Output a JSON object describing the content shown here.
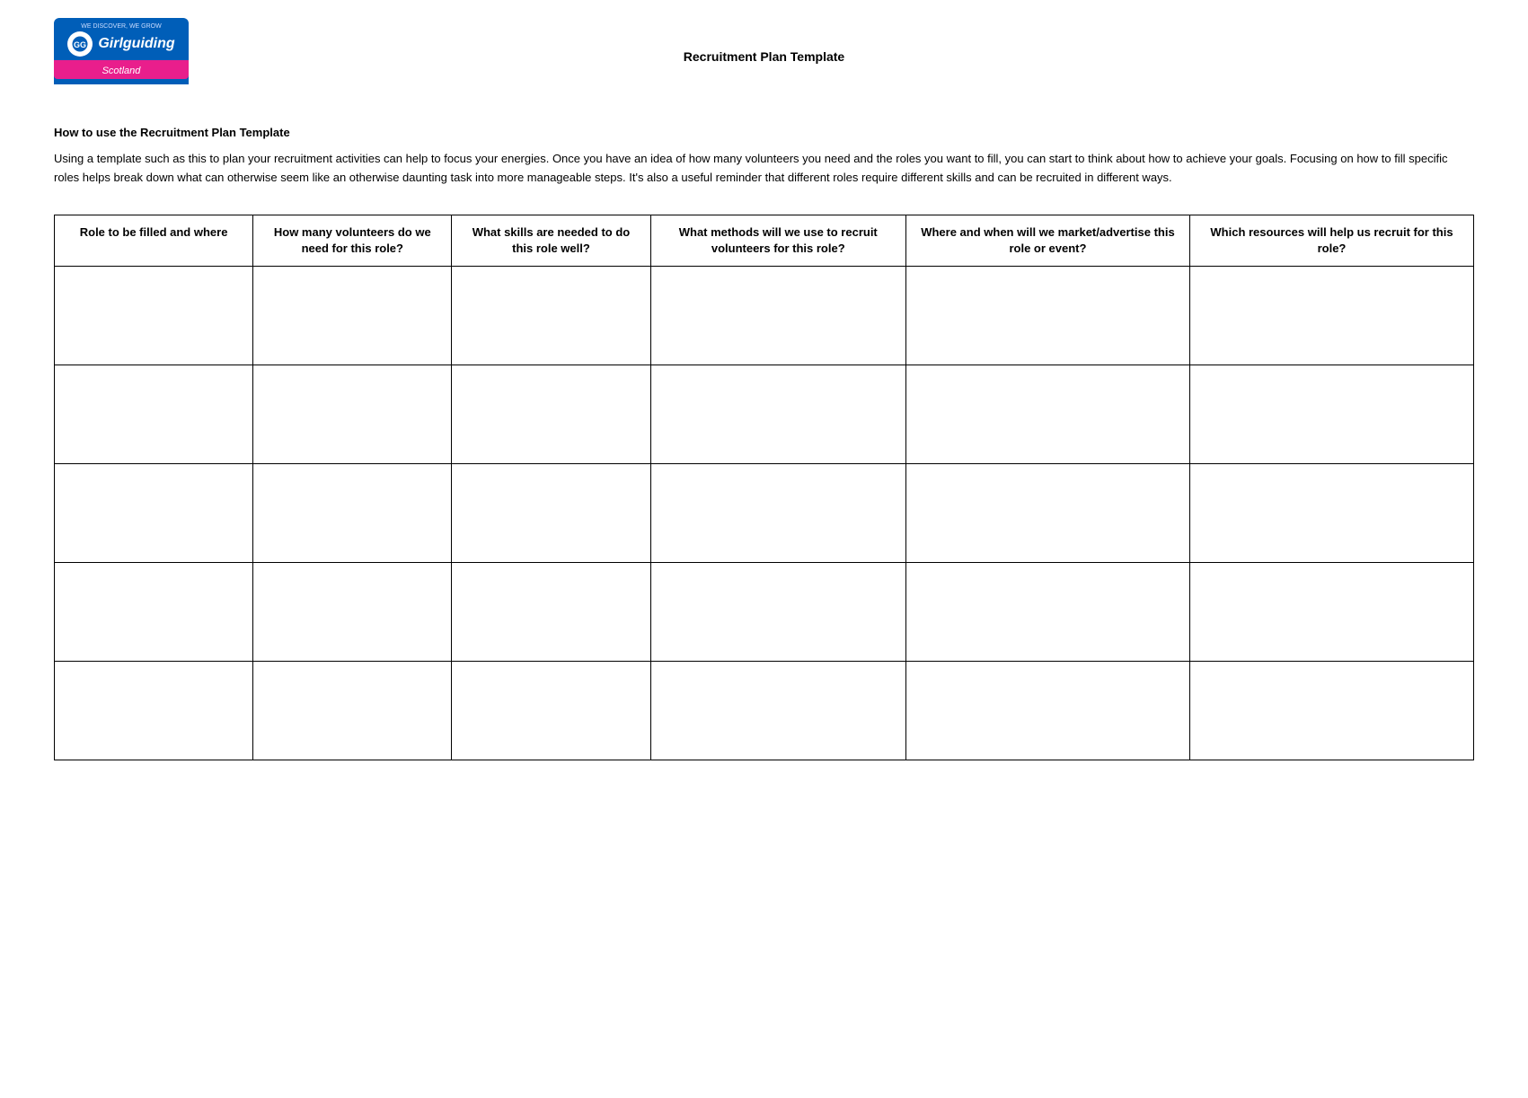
{
  "header": {
    "doc_title": "Recruitment Plan Template",
    "logo": {
      "tagline": "WE DISCOVER, WE GROW",
      "brand": "Girlguiding",
      "region": "Scotland"
    }
  },
  "intro": {
    "heading": "How to use the Recruitment Plan Template",
    "body": "Using a template such as this to plan your recruitment activities can help to focus your energies. Once you have an idea of how many volunteers you need and the roles you want to fill, you can start to think about how to achieve your goals. Focusing on how to fill specific roles helps break down what can otherwise seem like an otherwise daunting task into more manageable steps. It's also a useful reminder that different roles require different skills and can be recruited in different ways."
  },
  "table": {
    "headers": [
      "Role to be filled and where",
      "How many volunteers do we need for this role?",
      "What skills are needed to do this role well?",
      "What methods will we use to recruit volunteers for this role?",
      "Where and when will we market/advertise this role or event?",
      "Which resources will help us recruit for this role?"
    ],
    "rows": [
      [
        "",
        "",
        "",
        "",
        "",
        ""
      ],
      [
        "",
        "",
        "",
        "",
        "",
        ""
      ],
      [
        "",
        "",
        "",
        "",
        "",
        ""
      ],
      [
        "",
        "",
        "",
        "",
        "",
        ""
      ],
      [
        "",
        "",
        "",
        "",
        "",
        ""
      ]
    ]
  }
}
